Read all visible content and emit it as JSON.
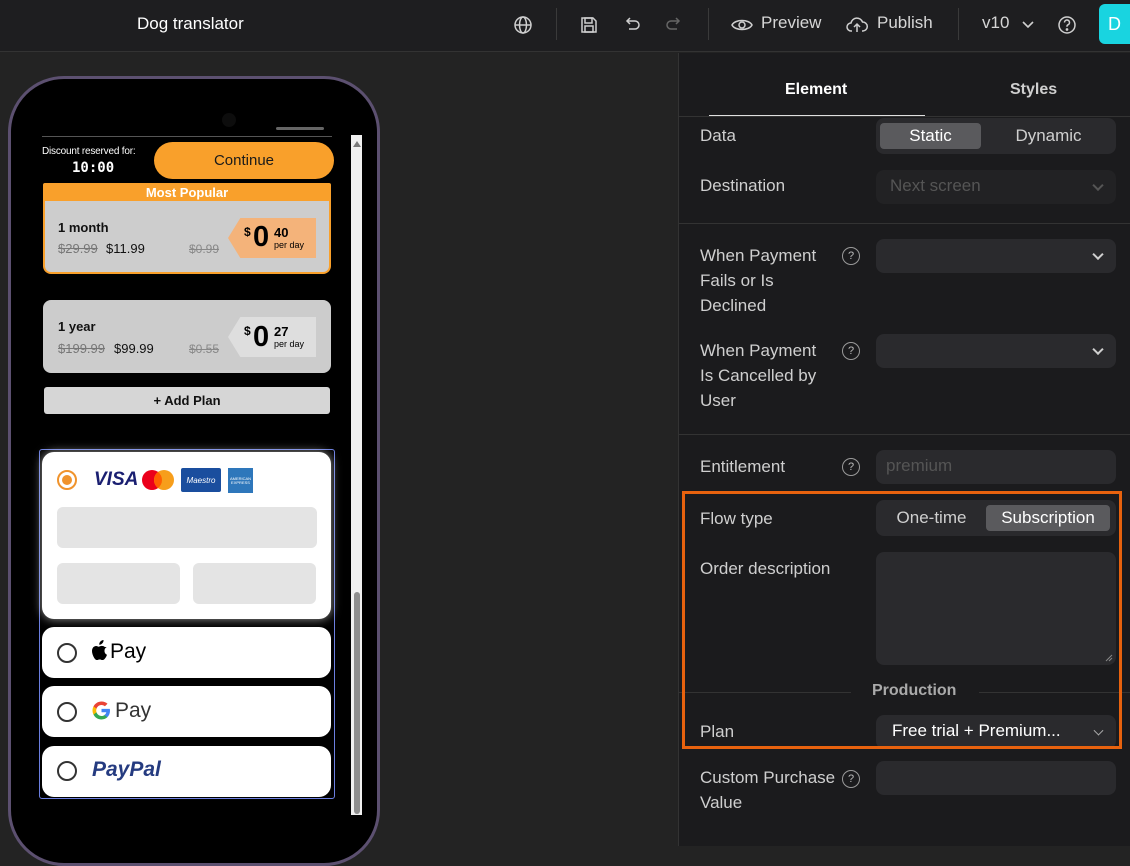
{
  "topbar": {
    "title": "Dog translator",
    "preview_label": "Preview",
    "publish_label": "Publish",
    "version": "v10",
    "avatar_initial": "D",
    "icons": [
      "globe-icon",
      "save-icon",
      "undo-icon",
      "redo-icon",
      "eye-icon",
      "cloud-upload-icon",
      "chevron-down-icon",
      "help-icon"
    ]
  },
  "preview": {
    "discount_label": "Discount reserved for:",
    "timer": "10:00",
    "continue_label": "Continue",
    "most_popular": "Most Popular",
    "plans": [
      {
        "name": "1 month",
        "old_price": "$29.99",
        "price": "$11.99",
        "old_daily": "$0.99",
        "currency": "$",
        "daily_int": "0",
        "daily_dec": "40",
        "per_day": "per day"
      },
      {
        "name": "1 year",
        "old_price": "$199.99",
        "price": "$99.99",
        "old_daily": "$0.55",
        "currency": "$",
        "daily_int": "0",
        "daily_dec": "27",
        "per_day": "per day"
      }
    ],
    "add_plan_label": "+ Add Plan",
    "card_brands": [
      "VISA",
      "Maestro",
      "AMERICAN EXPRESS"
    ],
    "apple_pay": "Pay",
    "google_pay": "Pay",
    "paypal": "PayPal",
    "colors": {
      "accent": "#f9a02b",
      "selected_radio": "#f0932c"
    }
  },
  "panel": {
    "tabs": [
      "Element",
      "Styles"
    ],
    "data_label": "Data",
    "data_options": [
      "Static",
      "Dynamic"
    ],
    "destination_label": "Destination",
    "destination_placeholder": "Next screen",
    "payment_fails_label": "When Payment Fails or Is Declined",
    "payment_cancelled_label": "When Payment Is Cancelled by User",
    "entitlement_label": "Entitlement",
    "entitlement_placeholder": "premium",
    "flow_type_label": "Flow type",
    "flow_type_options": [
      "One-time",
      "Subscription"
    ],
    "order_description_label": "Order description",
    "production_label": "Production",
    "plan_label": "Plan",
    "plan_value": "Free trial + Premium...",
    "custom_purchase_label": "Custom Purchase Value",
    "help_glyph": "?",
    "highlight_color": "#e8620e"
  }
}
